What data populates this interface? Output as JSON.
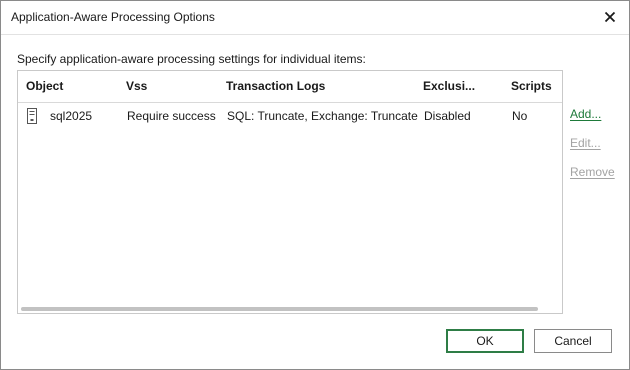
{
  "window": {
    "title": "Application-Aware Processing Options"
  },
  "instruction": "Specify application-aware processing settings for individual items:",
  "grid": {
    "columns": [
      "Object",
      "Vss",
      "Transaction Logs",
      "Exclusi...",
      "Scripts"
    ],
    "rows": [
      {
        "icon": "server-icon",
        "object": "sql2025",
        "vss": "Require success",
        "transaction_logs": "SQL: Truncate, Exchange: Truncate",
        "exclusions": "Disabled",
        "scripts": "No"
      }
    ]
  },
  "actions": {
    "add": "Add...",
    "edit": "Edit...",
    "remove": "Remove"
  },
  "buttons": {
    "ok": "OK",
    "cancel": "Cancel"
  },
  "colors": {
    "link": "#1e7a3a",
    "disabled": "#a3a3a3",
    "ok_border": "#2e7d46"
  }
}
